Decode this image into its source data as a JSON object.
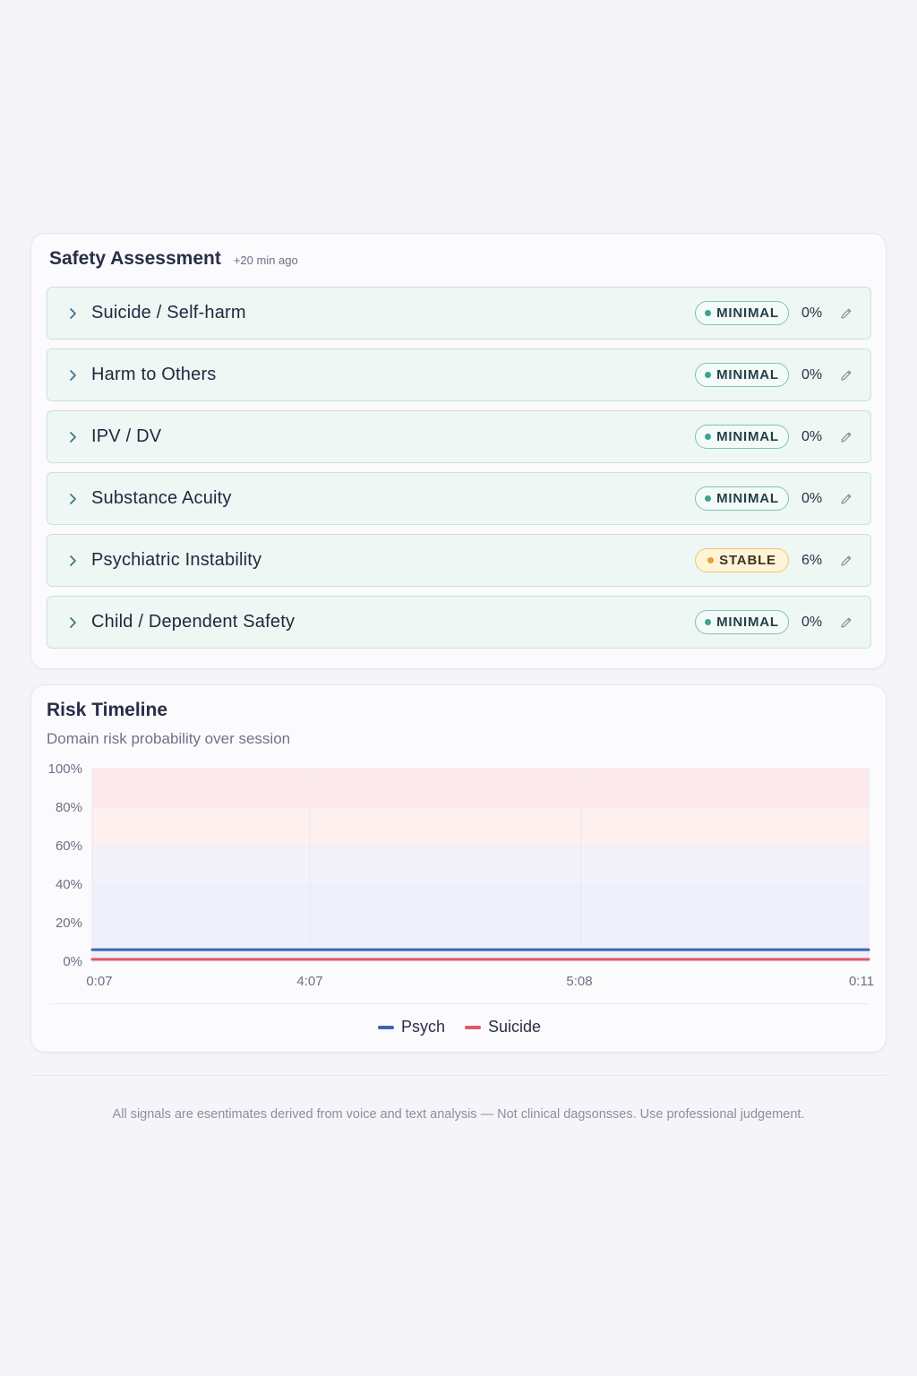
{
  "safety": {
    "title": "Safety Assessment",
    "meta": "+20 min ago",
    "rows": [
      {
        "label": "Suicide / Self-harm",
        "status": "MINIMAL",
        "level": "minimal",
        "pct": "0%"
      },
      {
        "label": "Harm to Others",
        "status": "MINIMAL",
        "level": "minimal",
        "pct": "0%"
      },
      {
        "label": "IPV / DV",
        "status": "MINIMAL",
        "level": "minimal",
        "pct": "0%"
      },
      {
        "label": "Substance Acuity",
        "status": "MINIMAL",
        "level": "minimal",
        "pct": "0%"
      },
      {
        "label": "Psychiatric Instability",
        "status": "STABLE",
        "level": "stable",
        "pct": "6%"
      },
      {
        "label": "Child / Dependent Safety",
        "status": "MINIMAL",
        "level": "minimal",
        "pct": "0%"
      }
    ],
    "colors": {
      "minimal_dot": "#3fa28c",
      "stable_dot": "#e6a232",
      "row_bg": "#eef7f4"
    }
  },
  "timeline": {
    "title": "Risk Timeline",
    "subtitle": "Domain risk probability over session"
  },
  "chart_data": {
    "type": "line",
    "x": [
      "0:07",
      "4:07",
      "5:08",
      "0:11"
    ],
    "ytick_labels": [
      "100%",
      "80%",
      "60%",
      "40%",
      "20%",
      "0%"
    ],
    "yticks": [
      100,
      80,
      60,
      40,
      20,
      0
    ],
    "ylim": [
      0,
      100
    ],
    "series": [
      {
        "name": "Psych",
        "values": [
          6,
          6,
          6,
          6
        ],
        "color": "#3b63b8"
      },
      {
        "name": "Suicide",
        "values": [
          1,
          1,
          1,
          1
        ],
        "color": "#dd5a66"
      }
    ],
    "bands": [
      {
        "from": 80,
        "to": 100,
        "color": "#fde8ec"
      },
      {
        "from": 60,
        "to": 80,
        "color": "#fdf0ef"
      },
      {
        "from": 40,
        "to": 60,
        "color": "#f3f1fa"
      },
      {
        "from": 0,
        "to": 40,
        "color": "#eef0fb"
      }
    ],
    "grid": true,
    "legend": "bottom-center"
  },
  "footer": {
    "text": "All signals are esentimates derived from voice and text analysis — Not clinical dagsonsses.  Use professional judgement."
  }
}
